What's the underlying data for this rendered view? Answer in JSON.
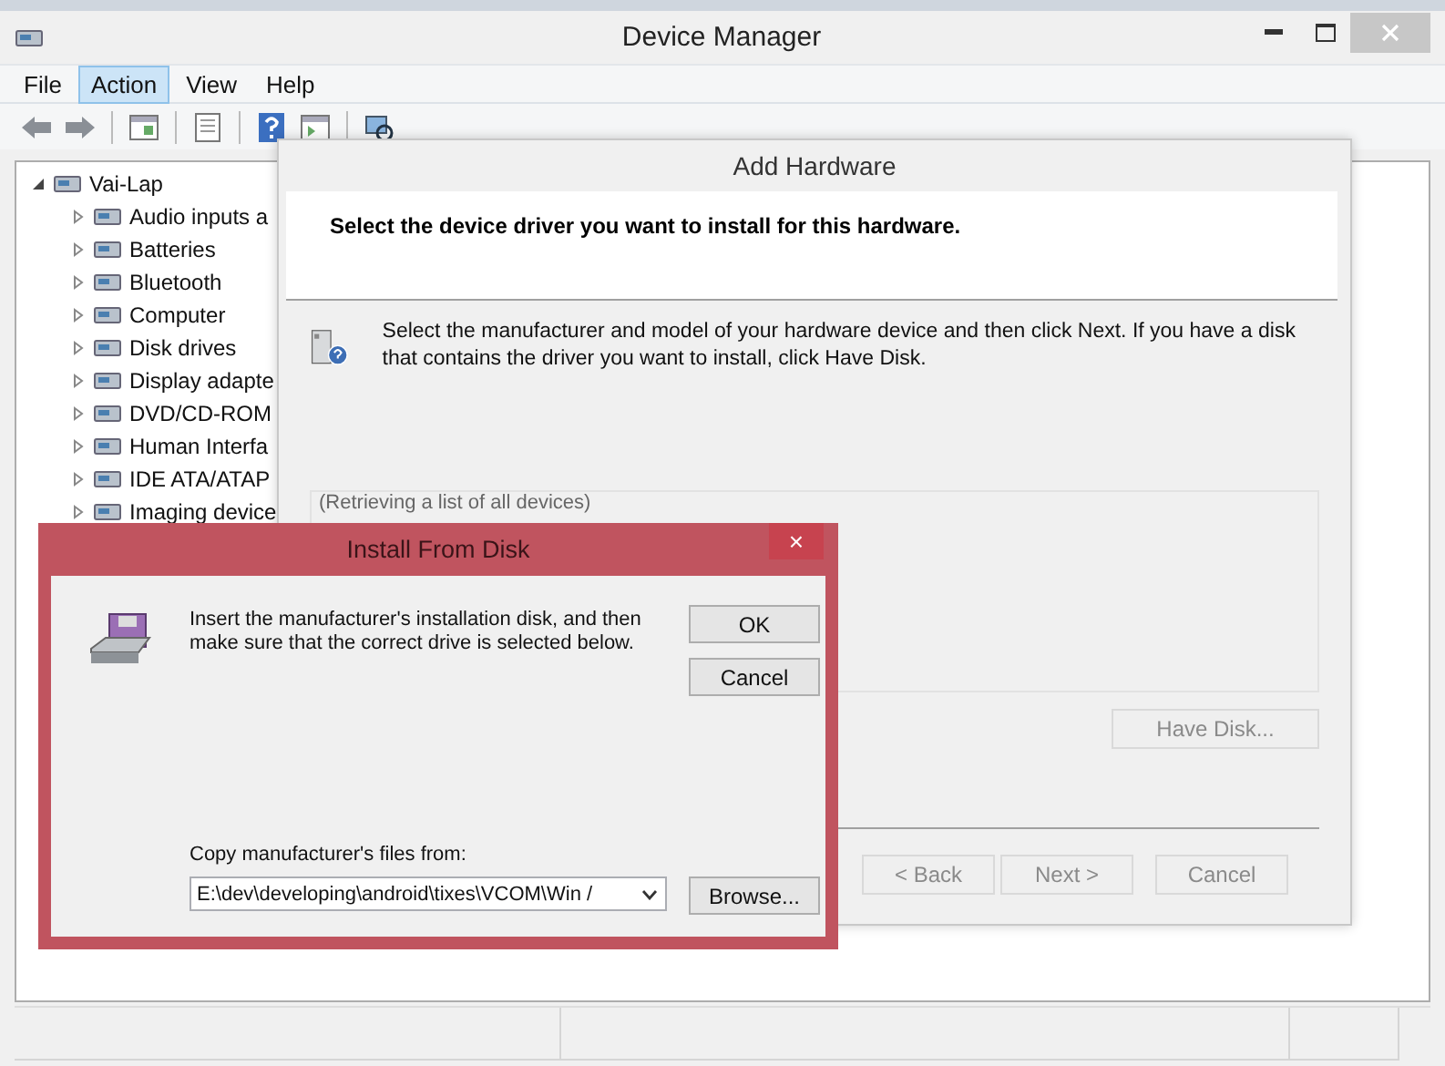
{
  "window": {
    "title": "Device Manager"
  },
  "menu": [
    {
      "label": "File",
      "selected": false
    },
    {
      "label": "Action",
      "selected": true
    },
    {
      "label": "View",
      "selected": false
    },
    {
      "label": "Help",
      "selected": false
    }
  ],
  "tree": {
    "label": "Vai-Lap",
    "expanded": true,
    "children": [
      {
        "label": "Audio inputs a",
        "expanded": false
      },
      {
        "label": "Batteries",
        "expanded": false
      },
      {
        "label": "Bluetooth",
        "expanded": false
      },
      {
        "label": "Computer",
        "expanded": false
      },
      {
        "label": "Disk drives",
        "expanded": false
      },
      {
        "label": "Display adapte",
        "expanded": false
      },
      {
        "label": "DVD/CD-ROM",
        "expanded": false
      },
      {
        "label": "Human Interfa",
        "expanded": false
      },
      {
        "label": "IDE ATA/ATAP",
        "expanded": false
      },
      {
        "label": "Imaging device",
        "expanded": false
      }
    ]
  },
  "add_hardware": {
    "title": "Add Hardware",
    "heading": "Select the device driver you want to install for this hardware.",
    "instructions": "Select the manufacturer and model of your hardware device and then click Next. If you have a disk that contains the driver you want to install, click Have Disk.",
    "list_status": "(Retrieving a list of all devices)",
    "have_disk": {
      "label": "Have Disk...",
      "disabled": true
    },
    "buttons": [
      {
        "label": "< Back",
        "disabled": true
      },
      {
        "label": "Next >",
        "disabled": true
      },
      {
        "label": "Cancel",
        "disabled": true
      }
    ]
  },
  "install_from_disk": {
    "title": "Install From Disk",
    "close": "×",
    "message": "Insert the manufacturer's installation disk, and then make sure that the correct drive is selected below.",
    "ok": "OK",
    "cancel": "Cancel",
    "path_label": "Copy manufacturer's files from:",
    "path": "E:\\dev\\developing\\android\\tixes\\VCOM\\Win /",
    "browse": "Browse..."
  }
}
